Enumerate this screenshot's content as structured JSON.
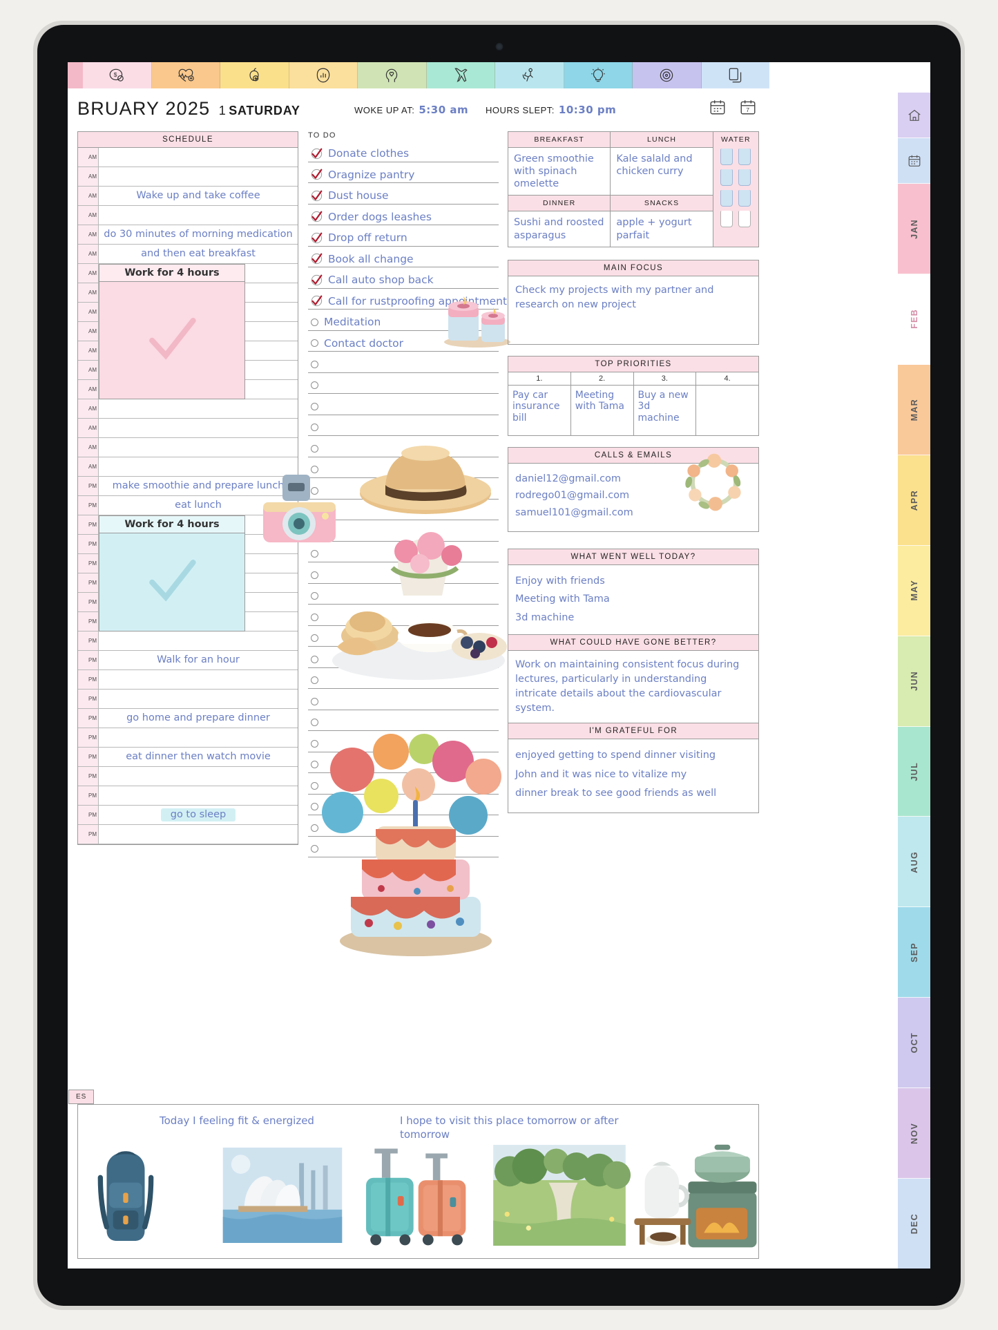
{
  "header": {
    "month_year": "BRUARY 2025",
    "day_number": "1",
    "weekday": "SATURDAY",
    "woke_up_label": "WOKE UP AT:",
    "woke_up_value": "5:30 am",
    "hours_slept_label": "HOURS SLEPT:",
    "hours_slept_value": "10:30 pm",
    "icons": [
      "calendar-icon",
      "calendar-week-icon"
    ]
  },
  "category_tabs": [
    {
      "name": "finance-icon"
    },
    {
      "name": "health-heartbeat-icon"
    },
    {
      "name": "nutrition-apple-icon"
    },
    {
      "name": "habit-chart-icon"
    },
    {
      "name": "mind-head-icon"
    },
    {
      "name": "travel-plane-icon"
    },
    {
      "name": "fitness-icon"
    },
    {
      "name": "idea-bulb-icon"
    },
    {
      "name": "goals-target-icon"
    },
    {
      "name": "pages-copy-icon"
    }
  ],
  "month_rail": {
    "top_icons": [
      "home-icon",
      "calendar-icon"
    ],
    "months": [
      "JAN",
      "FEB",
      "MAR",
      "APR",
      "MAY",
      "JUN",
      "JUL",
      "AUG",
      "SEP",
      "OCT",
      "NOV",
      "DEC"
    ],
    "active": "FEB"
  },
  "schedule": {
    "title": "SCHEDULE",
    "rows": [
      {
        "time": "AM",
        "text": ""
      },
      {
        "time": "AM",
        "text": ""
      },
      {
        "time": "AM",
        "text": "Wake up and take coffee"
      },
      {
        "time": "AM",
        "text": ""
      },
      {
        "time": "AM",
        "text": "do 30 minutes of morning medication"
      },
      {
        "time": "AM",
        "text": "and then eat breakfast"
      },
      {
        "time": "AM",
        "text": ""
      },
      {
        "time": "AM",
        "text": ""
      },
      {
        "time": "AM",
        "text": ""
      },
      {
        "time": "AM",
        "text": ""
      },
      {
        "time": "AM",
        "text": ""
      },
      {
        "time": "AM",
        "text": ""
      },
      {
        "time": "AM",
        "text": ""
      },
      {
        "time": "AM",
        "text": ""
      },
      {
        "time": "AM",
        "text": ""
      },
      {
        "time": "AM",
        "text": ""
      },
      {
        "time": "AM",
        "text": ""
      },
      {
        "time": "PM",
        "text": "make smoothie and prepare lunch"
      },
      {
        "time": "PM",
        "text": "eat lunch"
      },
      {
        "time": "PM",
        "text": ""
      },
      {
        "time": "PM",
        "text": ""
      },
      {
        "time": "PM",
        "text": ""
      },
      {
        "time": "PM",
        "text": ""
      },
      {
        "time": "PM",
        "text": ""
      },
      {
        "time": "PM",
        "text": ""
      },
      {
        "time": "PM",
        "text": ""
      },
      {
        "time": "PM",
        "text": "Walk for an hour"
      },
      {
        "time": "PM",
        "text": ""
      },
      {
        "time": "PM",
        "text": ""
      },
      {
        "time": "PM",
        "text": "go home and prepare dinner"
      },
      {
        "time": "PM",
        "text": ""
      },
      {
        "time": "PM",
        "text": "eat dinner then watch movie"
      },
      {
        "time": "PM",
        "text": ""
      },
      {
        "time": "PM",
        "text": ""
      },
      {
        "time": "PM",
        "text": "go to sleep"
      },
      {
        "time": "PM",
        "text": ""
      }
    ],
    "block_morning": {
      "label": "Work for 4 hours",
      "color": "#fbdbe4"
    },
    "block_afternoon": {
      "label": "Work for 4 hours",
      "color": "#d2f0f4"
    }
  },
  "todo": {
    "title": "TO DO",
    "items": [
      {
        "text": "Donate clothes",
        "done": true
      },
      {
        "text": "Oragnize pantry",
        "done": true
      },
      {
        "text": "Dust house",
        "done": true
      },
      {
        "text": "Order dogs leashes",
        "done": true
      },
      {
        "text": "Drop off return",
        "done": true
      },
      {
        "text": "Book all change",
        "done": true
      },
      {
        "text": "Call auto shop back",
        "done": true
      },
      {
        "text": "Call for rustproofing appointment",
        "done": true
      },
      {
        "text": "Meditation",
        "done": false
      },
      {
        "text": "Contact doctor",
        "done": false
      },
      {
        "text": "",
        "done": false
      },
      {
        "text": "",
        "done": false
      },
      {
        "text": "",
        "done": false
      },
      {
        "text": "",
        "done": false
      },
      {
        "text": "",
        "done": false
      },
      {
        "text": "",
        "done": false
      },
      {
        "text": "",
        "done": false
      },
      {
        "text": "",
        "done": false
      },
      {
        "text": "",
        "done": false
      },
      {
        "text": "",
        "done": false
      },
      {
        "text": "",
        "done": false
      },
      {
        "text": "",
        "done": false
      },
      {
        "text": "",
        "done": false
      },
      {
        "text": "",
        "done": false
      },
      {
        "text": "",
        "done": false
      },
      {
        "text": "",
        "done": false
      },
      {
        "text": "",
        "done": false
      },
      {
        "text": "",
        "done": false
      },
      {
        "text": "",
        "done": false
      },
      {
        "text": "",
        "done": false
      },
      {
        "text": "",
        "done": false
      },
      {
        "text": "",
        "done": false
      },
      {
        "text": "",
        "done": false
      },
      {
        "text": "",
        "done": false
      }
    ]
  },
  "meals": {
    "breakfast_label": "BREAKFAST",
    "breakfast_value": "Green smoothie with spinach omelette",
    "lunch_label": "LUNCH",
    "lunch_value": "Kale salald and chicken curry",
    "dinner_label": "DINNER",
    "dinner_value": "Sushi and roosted asparagus",
    "snacks_label": "SNACKS",
    "snacks_value": "apple + yogurt parfait",
    "water_label": "WATER",
    "water_filled": 6,
    "water_total": 8
  },
  "main_focus": {
    "title": "MAIN FOCUS",
    "text": "Check my projects with my partner and research on new project"
  },
  "top_priorities": {
    "title": "TOP PRIORITIES",
    "numbers": [
      "1.",
      "2.",
      "3.",
      "4."
    ],
    "items": [
      "Pay car insurance bill",
      "Meeting with Tama",
      "Buy a new 3d machine",
      ""
    ]
  },
  "calls_emails": {
    "title": "CALLS & EMAILS",
    "entries": [
      "daniel12@gmail.com",
      "rodrego01@gmail.com",
      "samuel101@gmail.com"
    ]
  },
  "went_well": {
    "title": "WHAT WENT WELL TODAY?",
    "lines": [
      "Enjoy with friends",
      "Meeting with Tama",
      "3d machine"
    ]
  },
  "gone_better": {
    "title": "WHAT COULD HAVE GONE BETTER?",
    "text": "Work on maintaining consistent focus during lectures, particularly in understanding intricate details about the cardiovascular system."
  },
  "grateful": {
    "title": "I'M GRATEFUL FOR",
    "lines": [
      "enjoyed getting to spend dinner visiting",
      "John and  it was nice to vitalize my",
      "dinner break  to see good friends as well"
    ]
  },
  "bottom": {
    "tab_label": "ES",
    "note_feeling": "Today I feeling fit & energized",
    "note_visit": "I hope to visit this place tomorrow or after tomorrow",
    "stickers": [
      "backpack-sticker",
      "opera-house-sticker",
      "suitcases-sticker",
      "landscape-sticker",
      "camp-stove-sticker"
    ]
  },
  "colors": {
    "header_band": "#fbdfe6",
    "handwriting": "#6b7fc4",
    "pink_block": "#fbdbe4",
    "blue_block": "#d2f0f4"
  }
}
